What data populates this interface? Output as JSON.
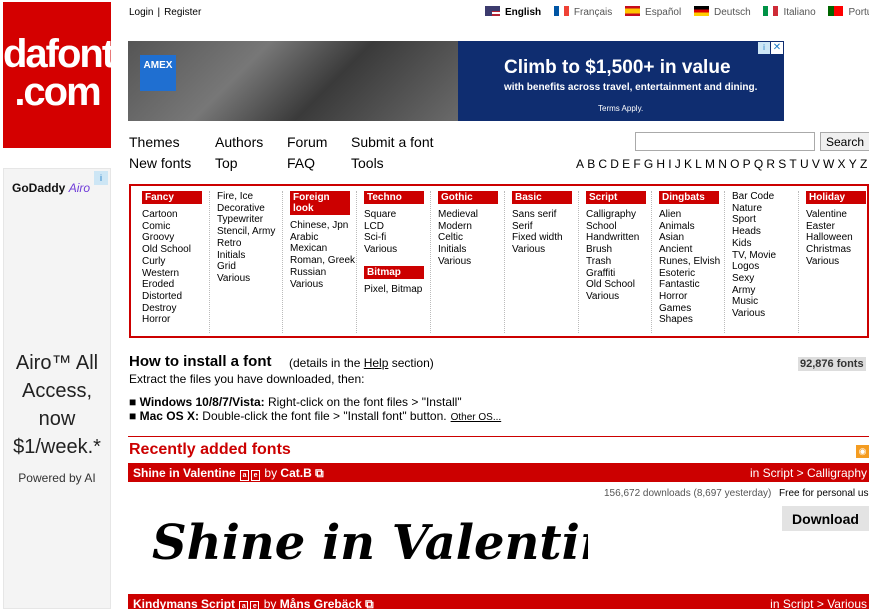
{
  "logo": {
    "line1": "dafont",
    "line2": ".com"
  },
  "top_links": {
    "login": "Login",
    "separator": "|",
    "register": "Register"
  },
  "languages": [
    {
      "label": "English",
      "active": true
    },
    {
      "label": "Français",
      "active": false
    },
    {
      "label": "Español",
      "active": false
    },
    {
      "label": "Deutsch",
      "active": false
    },
    {
      "label": "Italiano",
      "active": false
    },
    {
      "label": "Português",
      "active": false
    }
  ],
  "banner_ad": {
    "brand": "AMEX",
    "headline": "Climb to $1,500+ in value",
    "subline": "with benefits across travel, entertainment and dining.",
    "terms": "Terms Apply.",
    "ad_choices": "i",
    "close": "✕"
  },
  "left_ad": {
    "brand": "GoDaddy",
    "brand_suffix": "Airo",
    "headline": "Airo™ All Access, now $1/week.*",
    "powered_by": "Powered by AI",
    "ad_choices": "i"
  },
  "nav": {
    "themes": "Themes",
    "authors": "Authors",
    "forum": "Forum",
    "submit": "Submit a font",
    "new_fonts": "New fonts",
    "top": "Top",
    "faq": "FAQ",
    "tools": "Tools"
  },
  "search": {
    "placeholder": "",
    "button": "Search"
  },
  "alphabet": [
    "A",
    "B",
    "C",
    "D",
    "E",
    "F",
    "G",
    "H",
    "I",
    "J",
    "K",
    "L",
    "M",
    "N",
    "O",
    "P",
    "Q",
    "R",
    "S",
    "T",
    "U",
    "V",
    "W",
    "X",
    "Y",
    "Z",
    "#"
  ],
  "categories": [
    {
      "title": "Fancy",
      "items": [
        "Cartoon",
        "Comic",
        "Groovy",
        "Old School",
        "Curly",
        "Western",
        "Eroded",
        "Distorted",
        "Destroy",
        "Horror"
      ]
    },
    {
      "title": "",
      "items": [
        "Fire, Ice",
        "Decorative",
        "Typewriter",
        "Stencil, Army",
        "Retro",
        "Initials",
        "Grid",
        "Various"
      ]
    },
    {
      "title": "Foreign look",
      "items": [
        "Chinese, Jpn",
        "Arabic",
        "Mexican",
        "Roman, Greek",
        "Russian",
        "Various"
      ]
    },
    {
      "title": "Techno",
      "items": [
        "Square",
        "LCD",
        "Sci-fi",
        "Various"
      ],
      "sub_title": "Bitmap",
      "sub_items": [
        "Pixel, Bitmap"
      ]
    },
    {
      "title": "Gothic",
      "items": [
        "Medieval",
        "Modern",
        "Celtic",
        "Initials",
        "Various"
      ]
    },
    {
      "title": "Basic",
      "items": [
        "Sans serif",
        "Serif",
        "Fixed width",
        "Various"
      ]
    },
    {
      "title": "Script",
      "items": [
        "Calligraphy",
        "School",
        "Handwritten",
        "Brush",
        "Trash",
        "Graffiti",
        "Old School",
        "Various"
      ]
    },
    {
      "title": "Dingbats",
      "items": [
        "Alien",
        "Animals",
        "Asian",
        "Ancient",
        "Runes, Elvish",
        "Esoteric",
        "Fantastic",
        "Horror",
        "Games",
        "Shapes"
      ]
    },
    {
      "title": "",
      "items": [
        "Bar Code",
        "Nature",
        "Sport",
        "Heads",
        "Kids",
        "TV, Movie",
        "Logos",
        "Sexy",
        "Army",
        "Music",
        "Various"
      ]
    },
    {
      "title": "Holiday",
      "items": [
        "Valentine",
        "Easter",
        "Halloween",
        "Christmas",
        "Various"
      ]
    }
  ],
  "install": {
    "title": "How to install a font",
    "note_prefix": "(details in the ",
    "note_link": "Help",
    "note_suffix": " section)",
    "font_count": "92,876 fonts",
    "intro": "Extract the files you have downloaded, then:",
    "steps": [
      {
        "os": "Windows 10/8/7/Vista:",
        "text": " Right-click on the font files > \"Install\"",
        "extra": ""
      },
      {
        "os": "Mac OS X:",
        "text": " Double-click the font file > \"Install font\" button.",
        "extra": "Other OS..."
      }
    ]
  },
  "recent": {
    "title": "Recently added fonts",
    "rss_icon": "rss-icon"
  },
  "fonts": [
    {
      "name": "Shine in Valentine",
      "by_label": "by",
      "author": "Cat.B",
      "category": "in Script > Calligraphy",
      "downloads": "156,672 downloads (8,697 yesterday)",
      "license": "Free for personal use",
      "download_label": "Download",
      "preview": "Shine in Valentine"
    },
    {
      "name": "Kindymans Script",
      "by_label": "by",
      "author": "Måns Grebäck",
      "category": "in Script > Various"
    }
  ],
  "colors": {
    "brand_red": "#cc0000",
    "banner_blue": "#0f2d70"
  }
}
